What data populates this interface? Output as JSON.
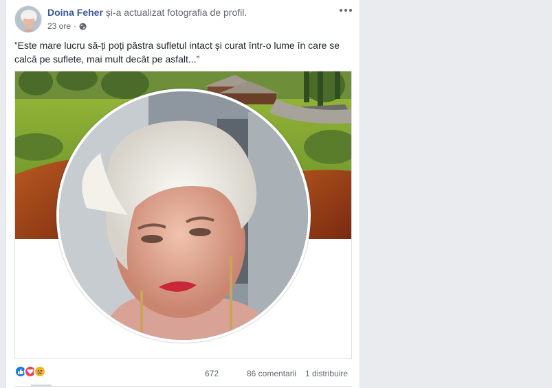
{
  "post": {
    "author": "Doina Feher",
    "action": "și-a actualizat fotografia de profil.",
    "time": "23 ore",
    "separator": "·",
    "privacy_icon": "globe-icon",
    "more_icon": "more-options-icon",
    "caption": "”Este mare lucru să-ți poți păstra sufletul intact și curat într-o lume în care se calcă pe suflete, mai mult decât pe asfalt...”"
  },
  "reactions": {
    "icons": [
      "like-icon",
      "love-icon",
      "sad-icon"
    ],
    "count": "672",
    "comments": "86 comentarii",
    "shares": "1 distribuire"
  },
  "colors": {
    "author_link": "#385898",
    "meta_text": "#616770",
    "like": "#1877f2",
    "love": "#f33e58",
    "sad": "#f7b125"
  }
}
